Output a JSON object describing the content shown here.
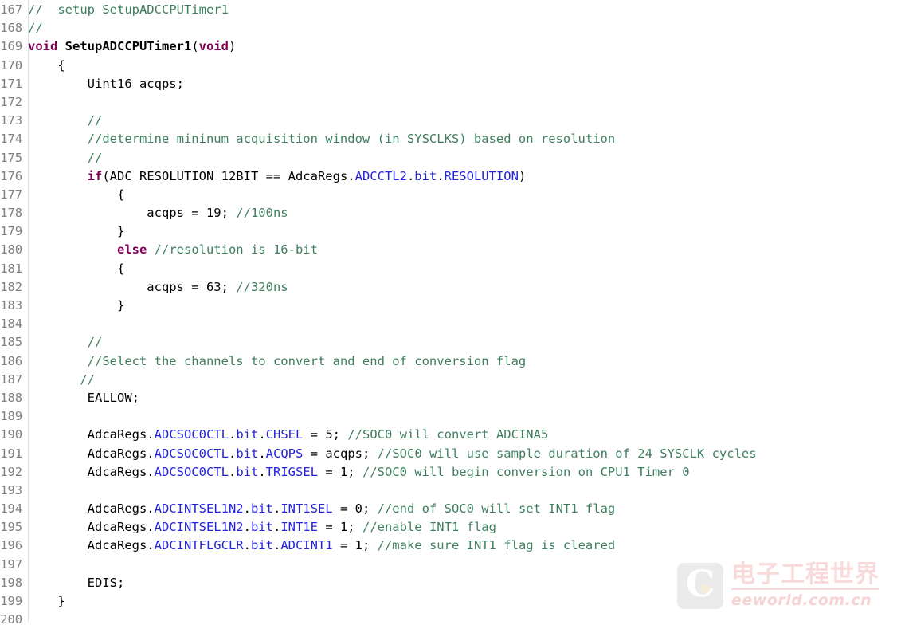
{
  "editor": {
    "language": "c",
    "first_line_number": 167,
    "last_line_number": 200,
    "colors": {
      "background": "#ffffff",
      "text": "#000000",
      "line_number": "#808080",
      "comment": "#3f7f5f",
      "keyword": "#7f0055",
      "struct_field": "#2323dc",
      "gutter_rule": "#e2e2e2"
    }
  },
  "watermark": {
    "logo_letter": "C",
    "chinese_text": "电子工程世界",
    "site_text": "eeworld.com.cn"
  },
  "lines": [
    {
      "num": "167",
      "tokens": [
        {
          "t": "comment",
          "s": "//  setup SetupADCCPUTimer1"
        }
      ]
    },
    {
      "num": "168",
      "tokens": [
        {
          "t": "comment",
          "s": "//"
        }
      ]
    },
    {
      "num": "169",
      "tokens": [
        {
          "t": "keyword",
          "s": "void"
        },
        {
          "t": "plain",
          "s": " "
        },
        {
          "t": "fname",
          "s": "SetupADCCPUTimer1"
        },
        {
          "t": "punct",
          "s": "("
        },
        {
          "t": "keyword",
          "s": "void"
        },
        {
          "t": "punct",
          "s": ")"
        }
      ]
    },
    {
      "num": "170",
      "tokens": [
        {
          "t": "plain",
          "s": "    {"
        }
      ]
    },
    {
      "num": "171",
      "tokens": [
        {
          "t": "plain",
          "s": "        Uint16 acqps;"
        }
      ]
    },
    {
      "num": "172",
      "tokens": []
    },
    {
      "num": "173",
      "tokens": [
        {
          "t": "plain",
          "s": "        "
        },
        {
          "t": "comment",
          "s": "//"
        }
      ]
    },
    {
      "num": "174",
      "tokens": [
        {
          "t": "plain",
          "s": "        "
        },
        {
          "t": "comment",
          "s": "//determine mininum acquisition window (in SYSCLKS) based on resolution"
        }
      ]
    },
    {
      "num": "175",
      "tokens": [
        {
          "t": "plain",
          "s": "        "
        },
        {
          "t": "comment",
          "s": "//"
        }
      ]
    },
    {
      "num": "176",
      "tokens": [
        {
          "t": "plain",
          "s": "        "
        },
        {
          "t": "keyword",
          "s": "if"
        },
        {
          "t": "punct",
          "s": "("
        },
        {
          "t": "plain",
          "s": "ADC_RESOLUTION_12BIT == AdcaRegs."
        },
        {
          "t": "field",
          "s": "ADCCTL2"
        },
        {
          "t": "punct",
          "s": "."
        },
        {
          "t": "field",
          "s": "bit"
        },
        {
          "t": "punct",
          "s": "."
        },
        {
          "t": "field",
          "s": "RESOLUTION"
        },
        {
          "t": "punct",
          "s": ")"
        }
      ]
    },
    {
      "num": "177",
      "tokens": [
        {
          "t": "plain",
          "s": "            {"
        }
      ]
    },
    {
      "num": "178",
      "tokens": [
        {
          "t": "plain",
          "s": "                acqps = 19; "
        },
        {
          "t": "comment",
          "s": "//100ns"
        }
      ]
    },
    {
      "num": "179",
      "tokens": [
        {
          "t": "plain",
          "s": "            }"
        }
      ]
    },
    {
      "num": "180",
      "tokens": [
        {
          "t": "plain",
          "s": "            "
        },
        {
          "t": "keyword",
          "s": "else"
        },
        {
          "t": "plain",
          "s": " "
        },
        {
          "t": "comment",
          "s": "//resolution is 16-bit"
        }
      ]
    },
    {
      "num": "181",
      "tokens": [
        {
          "t": "plain",
          "s": "            {"
        }
      ]
    },
    {
      "num": "182",
      "tokens": [
        {
          "t": "plain",
          "s": "                acqps = 63; "
        },
        {
          "t": "comment",
          "s": "//320ns"
        }
      ]
    },
    {
      "num": "183",
      "tokens": [
        {
          "t": "plain",
          "s": "            }"
        }
      ]
    },
    {
      "num": "184",
      "tokens": []
    },
    {
      "num": "185",
      "tokens": [
        {
          "t": "plain",
          "s": "        "
        },
        {
          "t": "comment",
          "s": "//"
        }
      ]
    },
    {
      "num": "186",
      "tokens": [
        {
          "t": "plain",
          "s": "        "
        },
        {
          "t": "comment",
          "s": "//Select the channels to convert and end of conversion flag"
        }
      ]
    },
    {
      "num": "187",
      "tokens": [
        {
          "t": "plain",
          "s": "       "
        },
        {
          "t": "comment",
          "s": "//"
        }
      ]
    },
    {
      "num": "188",
      "tokens": [
        {
          "t": "plain",
          "s": "        EALLOW;"
        }
      ]
    },
    {
      "num": "189",
      "tokens": []
    },
    {
      "num": "190",
      "tokens": [
        {
          "t": "plain",
          "s": "        AdcaRegs."
        },
        {
          "t": "field",
          "s": "ADCSOC0CTL"
        },
        {
          "t": "punct",
          "s": "."
        },
        {
          "t": "field",
          "s": "bit"
        },
        {
          "t": "punct",
          "s": "."
        },
        {
          "t": "field",
          "s": "CHSEL"
        },
        {
          "t": "plain",
          "s": " = 5; "
        },
        {
          "t": "comment",
          "s": "//SOC0 will convert ADCINA5"
        }
      ]
    },
    {
      "num": "191",
      "tokens": [
        {
          "t": "plain",
          "s": "        AdcaRegs."
        },
        {
          "t": "field",
          "s": "ADCSOC0CTL"
        },
        {
          "t": "punct",
          "s": "."
        },
        {
          "t": "field",
          "s": "bit"
        },
        {
          "t": "punct",
          "s": "."
        },
        {
          "t": "field",
          "s": "ACQPS"
        },
        {
          "t": "plain",
          "s": " = acqps; "
        },
        {
          "t": "comment",
          "s": "//SOC0 will use sample duration of 24 SYSCLK cycles"
        }
      ]
    },
    {
      "num": "192",
      "tokens": [
        {
          "t": "plain",
          "s": "        AdcaRegs."
        },
        {
          "t": "field",
          "s": "ADCSOC0CTL"
        },
        {
          "t": "punct",
          "s": "."
        },
        {
          "t": "field",
          "s": "bit"
        },
        {
          "t": "punct",
          "s": "."
        },
        {
          "t": "field",
          "s": "TRIGSEL"
        },
        {
          "t": "plain",
          "s": " = 1; "
        },
        {
          "t": "comment",
          "s": "//SOC0 will begin conversion on CPU1 Timer 0"
        }
      ]
    },
    {
      "num": "193",
      "tokens": []
    },
    {
      "num": "194",
      "tokens": [
        {
          "t": "plain",
          "s": "        AdcaRegs."
        },
        {
          "t": "field",
          "s": "ADCINTSEL1N2"
        },
        {
          "t": "punct",
          "s": "."
        },
        {
          "t": "field",
          "s": "bit"
        },
        {
          "t": "punct",
          "s": "."
        },
        {
          "t": "field",
          "s": "INT1SEL"
        },
        {
          "t": "plain",
          "s": " = 0; "
        },
        {
          "t": "comment",
          "s": "//end of SOC0 will set INT1 flag"
        }
      ]
    },
    {
      "num": "195",
      "tokens": [
        {
          "t": "plain",
          "s": "        AdcaRegs."
        },
        {
          "t": "field",
          "s": "ADCINTSEL1N2"
        },
        {
          "t": "punct",
          "s": "."
        },
        {
          "t": "field",
          "s": "bit"
        },
        {
          "t": "punct",
          "s": "."
        },
        {
          "t": "field",
          "s": "INT1E"
        },
        {
          "t": "plain",
          "s": " = 1; "
        },
        {
          "t": "comment",
          "s": "//enable INT1 flag"
        }
      ]
    },
    {
      "num": "196",
      "tokens": [
        {
          "t": "plain",
          "s": "        AdcaRegs."
        },
        {
          "t": "field",
          "s": "ADCINTFLGCLR"
        },
        {
          "t": "punct",
          "s": "."
        },
        {
          "t": "field",
          "s": "bit"
        },
        {
          "t": "punct",
          "s": "."
        },
        {
          "t": "field",
          "s": "ADCINT1"
        },
        {
          "t": "plain",
          "s": " = 1; "
        },
        {
          "t": "comment",
          "s": "//make sure INT1 flag is cleared"
        }
      ]
    },
    {
      "num": "197",
      "tokens": []
    },
    {
      "num": "198",
      "tokens": [
        {
          "t": "plain",
          "s": "        EDIS;"
        }
      ]
    },
    {
      "num": "199",
      "tokens": [
        {
          "t": "plain",
          "s": "    }"
        }
      ]
    },
    {
      "num": "200",
      "tokens": []
    }
  ]
}
